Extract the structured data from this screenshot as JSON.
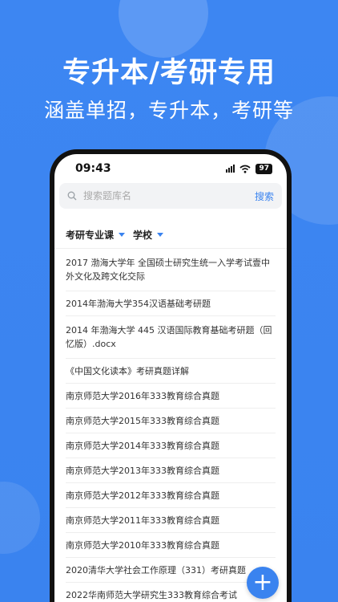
{
  "promo": {
    "headline": "专升本/考研专用",
    "subline": "涵盖单招，专升本，考研等"
  },
  "status_bar": {
    "time": "09:43",
    "battery": "97"
  },
  "search": {
    "placeholder": "搜索题库名",
    "button_label": "搜索"
  },
  "filters": {
    "category": "考研专业课",
    "school": "学校"
  },
  "list_items": [
    "2017 渤海大学年 全国硕士研究生统一入学考试壹中外文化及跨文化交际",
    "2014年渤海大学354汉语基础考研题",
    "2014 年渤海大学 445 汉语国际教育基础考研题（回忆版）.docx",
    "《中国文化读本》考研真题详解",
    "南京师范大学2016年333教育综合真题",
    "南京师范大学2015年333教育综合真题",
    "南京师范大学2014年333教育综合真题",
    "南京师范大学2013年333教育综合真题",
    "南京师范大学2012年333教育综合真题",
    "南京师范大学2011年333教育综合真题",
    "南京师范大学2010年333教育综合真题",
    "2020清华大学社会工作原理（331）考研真题",
    "2022华南师范大学研究生333教育综合考试"
  ],
  "fab_label": "+",
  "colors": {
    "brand_blue": "#3a83ef",
    "text_dark": "#333333"
  },
  "icons": {
    "search": "search-icon",
    "wifi": "wifi-icon",
    "signal": "signal-icon",
    "add": "plus-icon"
  }
}
